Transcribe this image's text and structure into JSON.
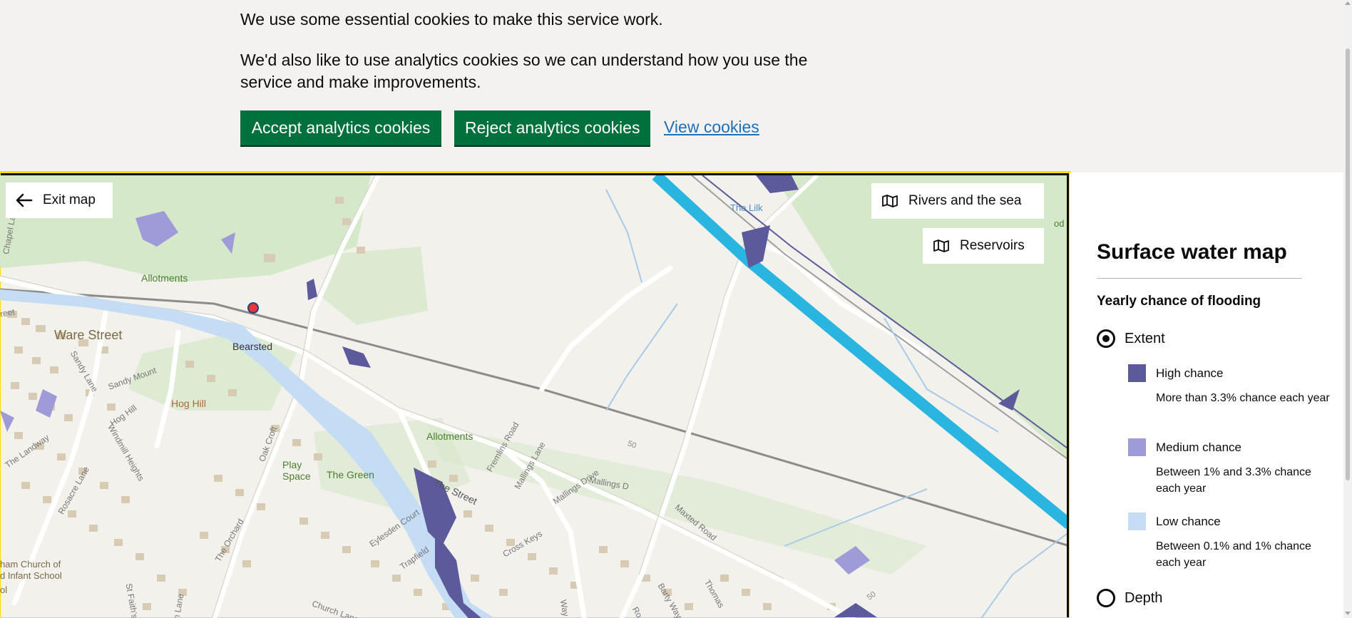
{
  "cookie_banner": {
    "line1": "We use some essential cookies to make this service work.",
    "line2": "We'd also like to use analytics cookies so we can understand how you use the service and make improvements.",
    "accept_label": "Accept analytics cookies",
    "reject_label": "Reject analytics cookies",
    "view_label": "View cookies"
  },
  "map": {
    "exit_label": "Exit map",
    "rivers_label": "Rivers and the sea",
    "reservoirs_label": "Reservoirs",
    "labels": {
      "ware_street": "Ware Street",
      "bearsted": "Bearsted",
      "allotments_1": "Allotments",
      "allotments_2": "Allotments",
      "hog_hill": "Hog Hill",
      "hog_hill_road": "Hog Hill",
      "sandy_mount": "Sandy Mount",
      "sandy_lane": "Sandy Lane",
      "the_landway": "The Landway",
      "windmill_heights": "Windmill Heights",
      "rosacre_lane": "Rosacre Lane",
      "oak_croft": "Oak Croft",
      "play_space": "Play\nSpace",
      "the_green": "The Green",
      "the_street": "The Street",
      "fremlins_road": "Fremlins Road",
      "mallings_lane": "Mallings Lane",
      "mallings_drive": "Mallings Drive",
      "mallings_d": "Mallings D",
      "maxted_road": "Maxted Road",
      "the_orchard": "The Orchard",
      "eylesden_court": "Eylesden Court",
      "trapfield": "Trapfield",
      "cross_keys": "Cross Keys",
      "church_lane": "Church Lane",
      "church_of": "ham Church of",
      "infant_school": "d Infant School",
      "ool": "ol",
      "st_faiths": "St Faith's",
      "n_lane": "n Lane",
      "the_lilk": "The Lilk",
      "od": "od",
      "fifty_1": "50",
      "fifty_2": "50",
      "cheel": "reet",
      "chapel_lane": "Chapel Lane",
      "way_1": "Way",
      "thomas": "Thomas",
      "barty_way": "Barty Way",
      "ro": "Ro"
    }
  },
  "panel": {
    "title": "Surface water map",
    "subtitle": "Yearly chance of flooding",
    "option_extent": "Extent",
    "option_depth": "Depth",
    "selected": "Extent",
    "key": [
      {
        "title": "High chance",
        "desc": "More than 3.3% chance each year",
        "color": "#5c5a9b"
      },
      {
        "title": "Medium chance",
        "desc": "Between 1% and 3.3% chance each year",
        "color": "#9e9bd8"
      },
      {
        "title": "Low chance",
        "desc": "Between 0.1% and 1% chance each year",
        "color": "#c5dcf5"
      }
    ]
  },
  "colors": {
    "button_green": "#00703c",
    "link_blue": "#1d70b8",
    "banner_bg": "#f3f2f1",
    "focus_yellow": "#ffdd00",
    "motorway_blue": "#29b5e0"
  },
  "icons": {
    "exit": "arrow-left-icon",
    "rivers": "map-icon",
    "reservoirs": "map-icon"
  }
}
